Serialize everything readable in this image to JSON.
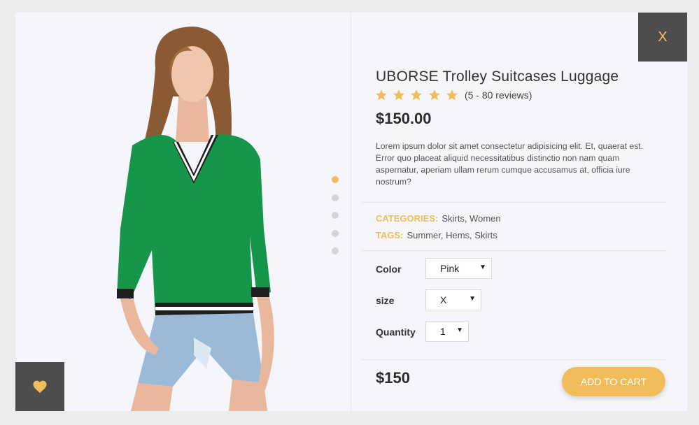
{
  "gallery": {
    "image_label": "Product photo",
    "dots": [
      true,
      false,
      false,
      false,
      false
    ]
  },
  "close": {
    "label": "X"
  },
  "product": {
    "title": "UBORSE Trolley Suitcases Luggage",
    "rating": {
      "stars": 5,
      "reviews_text": "(5 - 80 reviews)"
    },
    "price": "$150.00",
    "description": "Lorem ipsum dolor sit amet consectetur adipisicing elit. Et, quaerat est. Error quo placeat aliquid necessitatibus distinctio non nam quam aspernatur, aperiam ullam rerum cumque accusamus at, officia iure nostrum?",
    "categories": {
      "label": "CATEGORIES:",
      "value": "Skirts, Women"
    },
    "tags": {
      "label": "TAGS:",
      "value": "Summer, Hems, Skirts"
    }
  },
  "options": {
    "color": {
      "label": "Color",
      "selected": "Pink"
    },
    "size": {
      "label": "size",
      "selected": "X"
    },
    "quantity": {
      "label": "Quantity",
      "selected": "1"
    }
  },
  "footer": {
    "total": "$150",
    "add_to_cart": "ADD TO CART"
  },
  "colors": {
    "accent": "#f0bd5a",
    "dark": "#4d4d4d",
    "sweater": "#15964a"
  },
  "icons": {
    "wishlist": "heart-icon",
    "rating": "star-icon",
    "dropdown": "caret-down-icon"
  }
}
